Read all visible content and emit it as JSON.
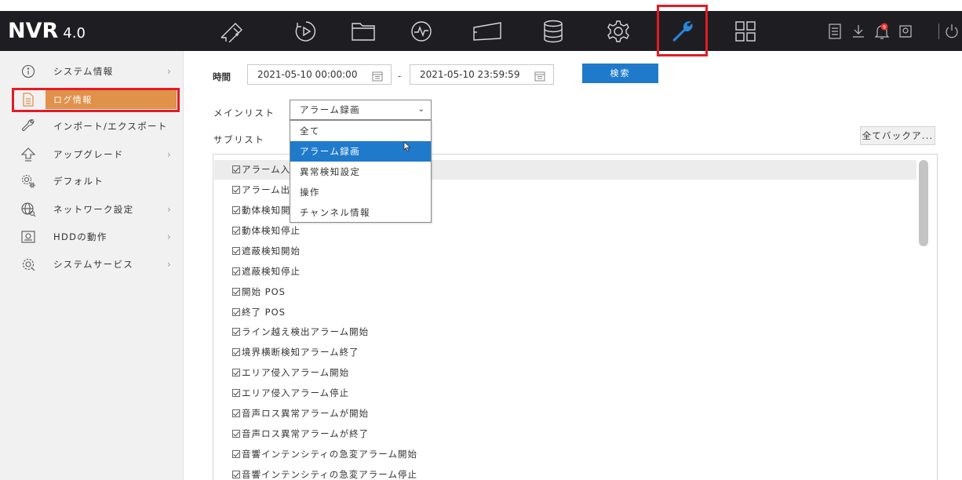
{
  "app": {
    "logo_main": "NVR",
    "logo_version": "4.0"
  },
  "topnav": {
    "icons": [
      "live-view-icon",
      "playback-icon",
      "file-icon",
      "smart-analysis-icon",
      "camera-icon",
      "storage-icon",
      "configuration-icon",
      "maintenance-icon",
      "multi-view-icon",
      "log-icon",
      "download-icon",
      "alarm-icon",
      "notification-icon",
      "power-icon"
    ],
    "alarm_badge": "9",
    "active": "maintenance-icon"
  },
  "sidebar": {
    "items": [
      {
        "label": "システム情報",
        "icon": "info-icon",
        "has_submenu": true
      },
      {
        "label": "ログ情報",
        "icon": "log-document-icon",
        "has_submenu": false,
        "active": true
      },
      {
        "label": "インポート/エクスポート",
        "icon": "import-export-icon",
        "has_submenu": false
      },
      {
        "label": "アップグレード",
        "icon": "upgrade-icon",
        "has_submenu": true
      },
      {
        "label": "デフォルト",
        "icon": "default-icon",
        "has_submenu": false
      },
      {
        "label": "ネットワーク設定",
        "icon": "network-icon",
        "has_submenu": true
      },
      {
        "label": "HDDの動作",
        "icon": "hdd-icon",
        "has_submenu": true
      },
      {
        "label": "システムサービス",
        "icon": "system-service-icon",
        "has_submenu": true
      }
    ],
    "chevron": "›"
  },
  "search": {
    "time_label": "時間",
    "start": "2021-05-10 00:00:00",
    "separator": "-",
    "end": "2021-05-10 23:59:59",
    "button": "検索"
  },
  "mainlist": {
    "label": "メインリスト",
    "selected": "アラーム録画",
    "caret": "⌄"
  },
  "dropdown": {
    "options": [
      "全て",
      "アラーム録画",
      "異常検知設定",
      "操作",
      "チャンネル情報"
    ],
    "highlighted_index": 1
  },
  "sublist": {
    "label": "サブリスト",
    "backup_button": "全てバックア...",
    "items": [
      "アラーム入",
      "アラーム出",
      "動体検知開",
      "動体検知停止",
      "遮蔽検知開始",
      "遮蔽検知停止",
      "開始 POS",
      "終了 POS",
      "ライン越え検出アラーム開始",
      "境界横断検知アラーム終了",
      "エリア侵入アラーム開始",
      "エリア侵入アラーム停止",
      "音声ロス異常アラームが開始",
      "音声ロス異常アラームが終了",
      "音響インテンシティの急変アラーム開始",
      "音響インテンシティの急変アラーム停止"
    ]
  }
}
